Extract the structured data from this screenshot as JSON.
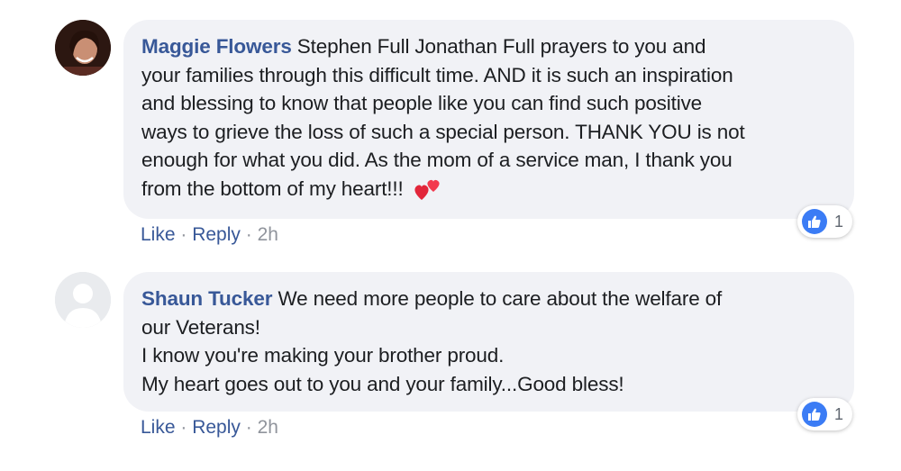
{
  "comments": [
    {
      "author": "Maggie Flowers",
      "lines": [
        "Stephen Full Jonathan Full prayers to you and",
        "your families through this difficult time. AND it is such an inspiration",
        "and blessing to know that people like you can find such positive",
        "ways to grieve the loss of such a special person. THANK YOU is not",
        "enough for what you did. As the mom of a service man, I thank you",
        "from the bottom of my heart!!!"
      ],
      "emoji": "two-hearts-icon",
      "actions": {
        "like": "Like",
        "reply": "Reply",
        "time": "2h"
      },
      "reaction_count": "1",
      "avatar": "profile-photo"
    },
    {
      "author": "Shaun Tucker",
      "lines": [
        "We need more people to care about the welfare of",
        "our Veterans!",
        "I know you're making your brother proud.",
        "My heart goes out to you and your family...Good bless!"
      ],
      "actions": {
        "like": "Like",
        "reply": "Reply",
        "time": "2h"
      },
      "reaction_count": "1",
      "avatar": "default-avatar-icon"
    }
  ],
  "separator": "·",
  "colors": {
    "link": "#385898",
    "bubble": "#f1f2f6",
    "like_badge": "#3b7cf5"
  }
}
